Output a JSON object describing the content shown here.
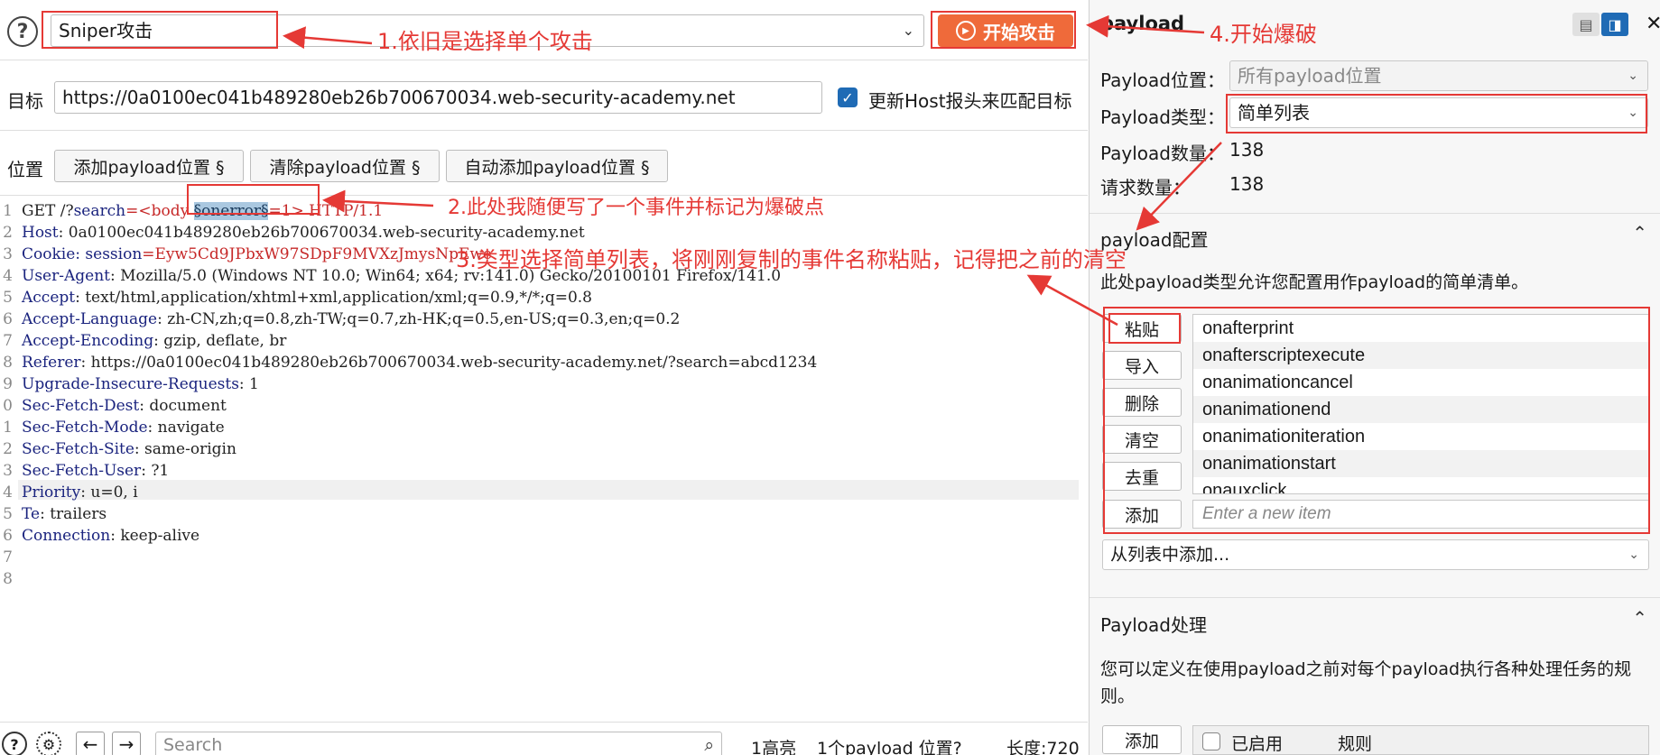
{
  "toolbar": {
    "help_glyph": "?",
    "attack_type": "Sniper攻击",
    "start_label": "开始攻击"
  },
  "target": {
    "label": "目标",
    "url": "https://0a0100ec041b489280eb26b700670034.web-security-academy.net",
    "host_checkbox_label": "更新Host报头来匹配目标"
  },
  "positions": {
    "label": "位置",
    "buttons": [
      "添加payload位置 §",
      "清除payload位置 §",
      "自动添加payload位置 §"
    ]
  },
  "request": {
    "line_numbers": [
      "1",
      "2",
      "3",
      "4",
      "5",
      "6",
      "7",
      "8",
      "9",
      "0",
      "1",
      "2",
      "3",
      "4",
      "5",
      "6",
      "7",
      "8"
    ],
    "line1_prefix": "GET /?",
    "line1_param": "search",
    "line1_eq": "=<body ",
    "line1_marker": "§onerror§",
    "line1_suffix": "=1> HTTP/1.1",
    "host_key": "Host",
    "host_val": ": 0a0100ec041b489280eb26b700670034.web-security-academy.net",
    "cookie_key": "Cookie",
    "cookie_name": ": session",
    "cookie_val": "=Eyw5Cd9JPbxW97SDpF9MVXzJmysNpEwe",
    "headers": [
      {
        "k": "User-Agent",
        "v": ": Mozilla/5.0 (Windows NT 10.0; Win64; x64; rv:141.0) Gecko/20100101 Firefox/141.0"
      },
      {
        "k": "Accept",
        "v": ": text/html,application/xhtml+xml,application/xml;q=0.9,*/*;q=0.8"
      },
      {
        "k": "Accept-Language",
        "v": ": zh-CN,zh;q=0.8,zh-TW;q=0.7,zh-HK;q=0.5,en-US;q=0.3,en;q=0.2"
      },
      {
        "k": "Accept-Encoding",
        "v": ": gzip, deflate, br"
      },
      {
        "k": "Referer",
        "v": ": https://0a0100ec041b489280eb26b700670034.web-security-academy.net/?search=abcd1234"
      },
      {
        "k": "Upgrade-Insecure-Requests",
        "v": ": 1"
      },
      {
        "k": "Sec-Fetch-Dest",
        "v": ": document"
      },
      {
        "k": "Sec-Fetch-Mode",
        "v": ": navigate"
      },
      {
        "k": "Sec-Fetch-Site",
        "v": ": same-origin"
      },
      {
        "k": "Sec-Fetch-User",
        "v": ": ?1"
      },
      {
        "k": "Priority",
        "v": ": u=0, i"
      },
      {
        "k": "Te",
        "v": ": trailers"
      },
      {
        "k": "Connection",
        "v": ": keep-alive"
      }
    ]
  },
  "statusbar": {
    "search_placeholder": "Search",
    "highlights": "1高亮",
    "positions": "1个payload 位置?",
    "length": "长度:720"
  },
  "panel": {
    "title": "payload",
    "position_label": "Payload位置：",
    "position_value": "所有payload位置",
    "type_label": "Payload类型：",
    "type_value": "简单列表",
    "count_label": "Payload数量：",
    "count_value": "138",
    "requests_label": "请求数量：",
    "requests_value": "138",
    "config_title": "payload配置",
    "config_desc": "此处payload类型允许您配置用作payload的简单清单。",
    "buttons": [
      "粘贴",
      "导入",
      "删除",
      "清空",
      "去重"
    ],
    "add_button": "添加",
    "items": [
      "onafterprint",
      "onafterscriptexecute",
      "onanimationcancel",
      "onanimationend",
      "onanimationiteration",
      "onanimationstart",
      "onauxclick"
    ],
    "new_item_placeholder": "Enter a new item",
    "add_from_list": "从列表中添加...",
    "processing_title": "Payload处理",
    "processing_desc": "您可以定义在使用payload之前对每个payload执行各种处理任务的规则。",
    "processing_add": "添加",
    "col_enabled": "已启用",
    "col_rule": "规则"
  },
  "annotations": {
    "a1": "1.依旧是选择单个攻击",
    "a2": "2.此处我随便写了一个事件并标记为爆破点",
    "a3": "3.类型选择简单列表，将刚刚复制的事件名称粘贴，记得把之前的清空",
    "a4": "4.开始爆破"
  },
  "colors": {
    "accent": "#ef6a3a",
    "annotation": "#e53935",
    "marker_bg": "#aac8e0",
    "checkbox": "#1f6bb5"
  }
}
